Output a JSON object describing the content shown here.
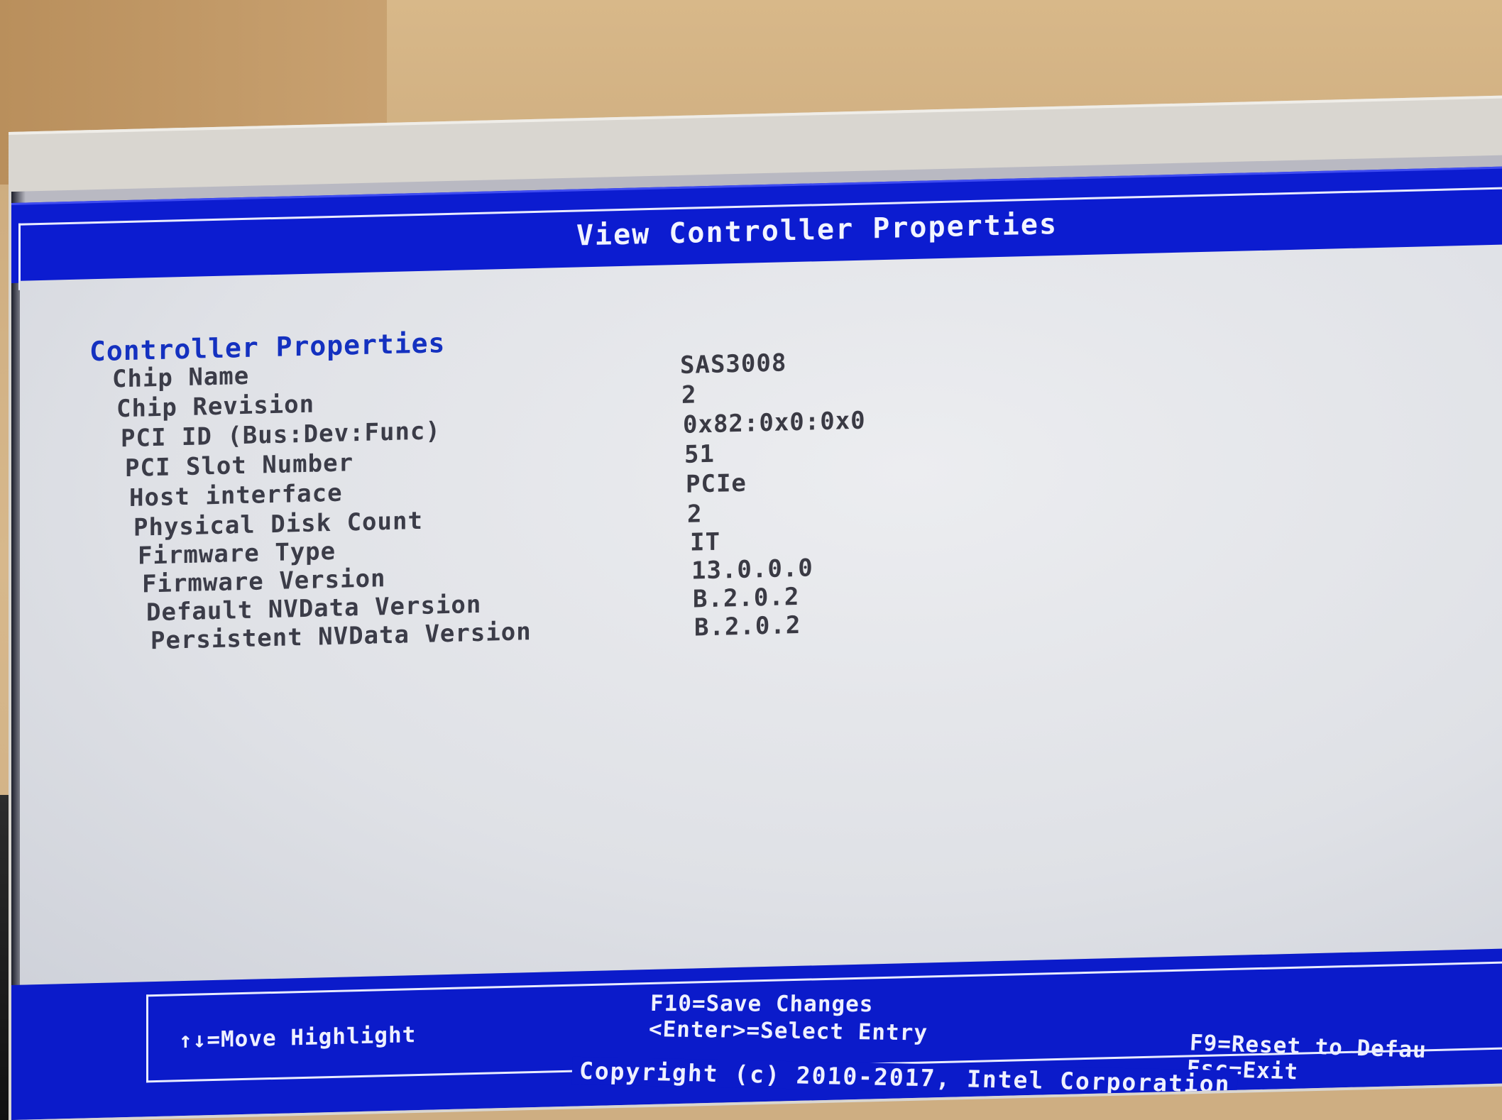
{
  "window": {
    "title": "View Controller Properties"
  },
  "section": {
    "title": "Controller Properties"
  },
  "properties": [
    {
      "label": "Chip Name",
      "value": "SAS3008"
    },
    {
      "label": "Chip Revision",
      "value": "2"
    },
    {
      "label": "PCI ID (Bus:Dev:Func)",
      "value": "0x82:0x0:0x0"
    },
    {
      "label": "PCI Slot Number",
      "value": "51"
    },
    {
      "label": "Host interface",
      "value": "PCIe"
    },
    {
      "label": "Physical Disk Count",
      "value": "2"
    },
    {
      "label": "Firmware Type",
      "value": "IT"
    },
    {
      "label": "Firmware Version",
      "value": "13.0.0.0"
    },
    {
      "label": "Default NVData Version",
      "value": "B.2.0.2"
    },
    {
      "label": "Persistent NVData Version",
      "value": "B.2.0.2"
    }
  ],
  "footer": {
    "move_highlight": "↑↓=Move Highlight",
    "save_changes": "F10=Save Changes",
    "select_entry": "<Enter>=Select Entry",
    "reset_defaults": "F9=Reset to Defau",
    "exit": "Esc=Exit",
    "copyright": "Copyright (c) 2010-2017, Intel Corporation"
  },
  "colors": {
    "title_bar": "#0c1cd0",
    "section_title": "#1431c0",
    "content_bg": "#e4e6ea"
  }
}
